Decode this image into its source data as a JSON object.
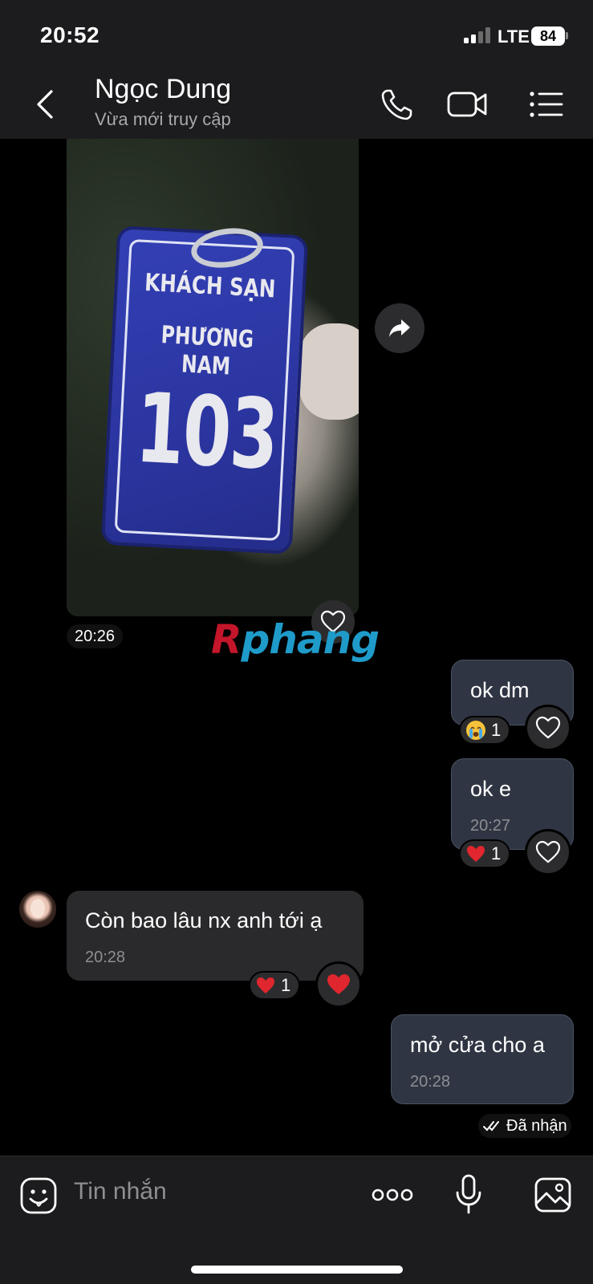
{
  "status_bar": {
    "time": "20:52",
    "network": "LTE",
    "battery": "84"
  },
  "header": {
    "contact_name": "Ngọc Dung",
    "contact_status": "Vừa mới truy cập"
  },
  "photo_message": {
    "sign_line1": "KHÁCH SẠN",
    "sign_line2": "PHƯƠNG NAM",
    "sign_number": "103",
    "time": "20:26"
  },
  "watermark": {
    "first": "R",
    "rest": "phang"
  },
  "messages": [
    {
      "direction": "out",
      "text": "ok dm",
      "time": "",
      "reaction": {
        "emoji": "crying-face",
        "count": "1"
      }
    },
    {
      "direction": "out",
      "text": "ok e",
      "time": "20:27",
      "reaction": {
        "emoji": "red-heart",
        "count": "1"
      }
    },
    {
      "direction": "in",
      "text": "Còn bao lâu nx anh tới ạ",
      "time": "20:28",
      "reaction": {
        "emoji": "red-heart",
        "count": "1"
      }
    },
    {
      "direction": "out",
      "text": "mở cửa cho a",
      "time": "20:28"
    }
  ],
  "delivery_status": "Đã nhận",
  "composer": {
    "placeholder": "Tin nhắn"
  },
  "colors": {
    "background": "#000000",
    "header": "#1c1c1e",
    "outgoing_bubble": "#2f3542",
    "incoming_bubble": "#2a2a2c",
    "heart": "#e0262e"
  }
}
